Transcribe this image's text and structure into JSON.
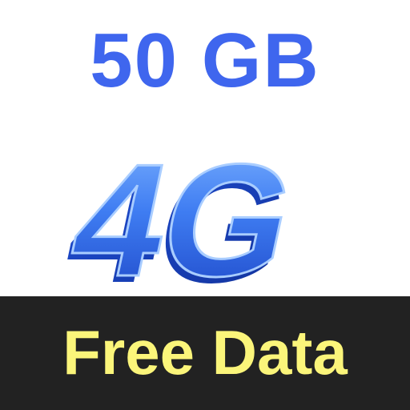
{
  "headline": {
    "text": "50 GB"
  },
  "logo": {
    "text": "4G",
    "icon": "4g-logo-icon"
  },
  "banner": {
    "text": "Free Data"
  },
  "colors": {
    "headline": "#3f66ee",
    "logo_light": "#6ea8ff",
    "logo_dark": "#1b47c9",
    "banner_bg": "#222222",
    "banner_text": "#fbf57a"
  }
}
